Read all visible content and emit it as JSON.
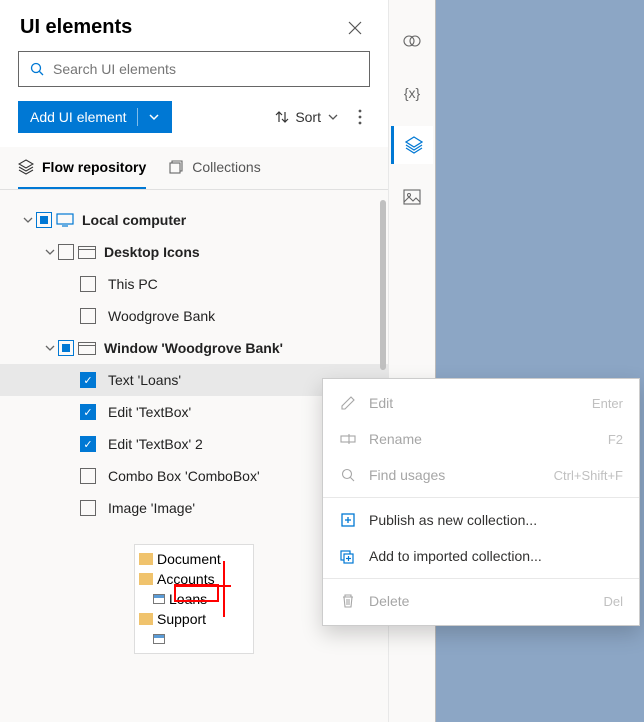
{
  "header": {
    "title": "UI elements"
  },
  "search": {
    "placeholder": "Search UI elements"
  },
  "toolbar": {
    "add_label": "Add UI element",
    "sort_label": "Sort"
  },
  "tabs": {
    "flow": "Flow repository",
    "collections": "Collections"
  },
  "tree": {
    "root": "Local computer",
    "desktop": "Desktop Icons",
    "desktop_children": [
      {
        "label": "This PC"
      },
      {
        "label": "Woodgrove Bank"
      }
    ],
    "window": "Window 'Woodgrove Bank'",
    "window_children": [
      {
        "label": "Text 'Loans'",
        "checked": true,
        "selected": true
      },
      {
        "label": "Edit 'TextBox'",
        "checked": true
      },
      {
        "label": "Edit 'TextBox' 2",
        "checked": true
      },
      {
        "label": "Combo Box 'ComboBox'",
        "checked": false
      },
      {
        "label": "Image 'Image'",
        "checked": false
      }
    ]
  },
  "preview": {
    "lines": [
      "Document",
      "Accounts",
      "Loans",
      "Support"
    ]
  },
  "ctx": {
    "edit": "Edit",
    "edit_key": "Enter",
    "rename": "Rename",
    "rename_key": "F2",
    "find": "Find usages",
    "find_key": "Ctrl+Shift+F",
    "publish": "Publish as new collection...",
    "add": "Add to imported collection...",
    "delete": "Delete",
    "delete_key": "Del"
  }
}
